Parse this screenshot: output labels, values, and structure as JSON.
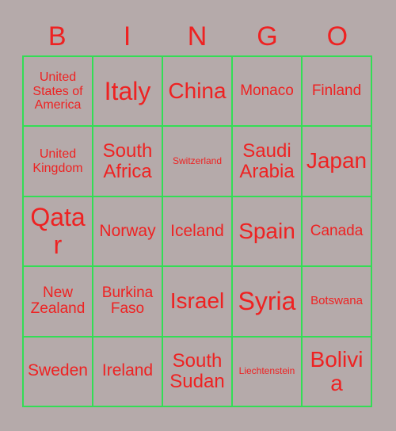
{
  "card": {
    "title": "BINGO",
    "header_letters": [
      "B",
      "I",
      "N",
      "G",
      "O"
    ],
    "text_color": "#ee2222",
    "grid_line_color": "#33dd55",
    "background_color": "#b5aaaa",
    "columns": 5,
    "rows": 5
  },
  "cells": [
    {
      "label": "United States of America",
      "size": "sz-m"
    },
    {
      "label": "Italy",
      "size": "sz-max"
    },
    {
      "label": "China",
      "size": "sz-xxl"
    },
    {
      "label": "Monaco",
      "size": "sz-ml"
    },
    {
      "label": "Finland",
      "size": "sz-ml"
    },
    {
      "label": "United Kingdom",
      "size": "sz-m"
    },
    {
      "label": "South Africa",
      "size": "sz-xl"
    },
    {
      "label": "Switzerland",
      "size": "sz-xs"
    },
    {
      "label": "Saudi Arabia",
      "size": "sz-xl"
    },
    {
      "label": "Japan",
      "size": "sz-xxl"
    },
    {
      "label": "Qatar",
      "size": "sz-max"
    },
    {
      "label": "Norway",
      "size": "sz-l"
    },
    {
      "label": "Iceland",
      "size": "sz-l"
    },
    {
      "label": "Spain",
      "size": "sz-xxl"
    },
    {
      "label": "Canada",
      "size": "sz-ml"
    },
    {
      "label": "New Zealand",
      "size": "sz-ml"
    },
    {
      "label": "Burkina Faso",
      "size": "sz-ml"
    },
    {
      "label": "Israel",
      "size": "sz-xxl"
    },
    {
      "label": "Syria",
      "size": "sz-max"
    },
    {
      "label": "Botswana",
      "size": "sz-s"
    },
    {
      "label": "Sweden",
      "size": "sz-l"
    },
    {
      "label": "Ireland",
      "size": "sz-l"
    },
    {
      "label": "South Sudan",
      "size": "sz-xl"
    },
    {
      "label": "Liechtenstein",
      "size": "sz-xs"
    },
    {
      "label": "Bolivia",
      "size": "sz-xxl"
    }
  ]
}
